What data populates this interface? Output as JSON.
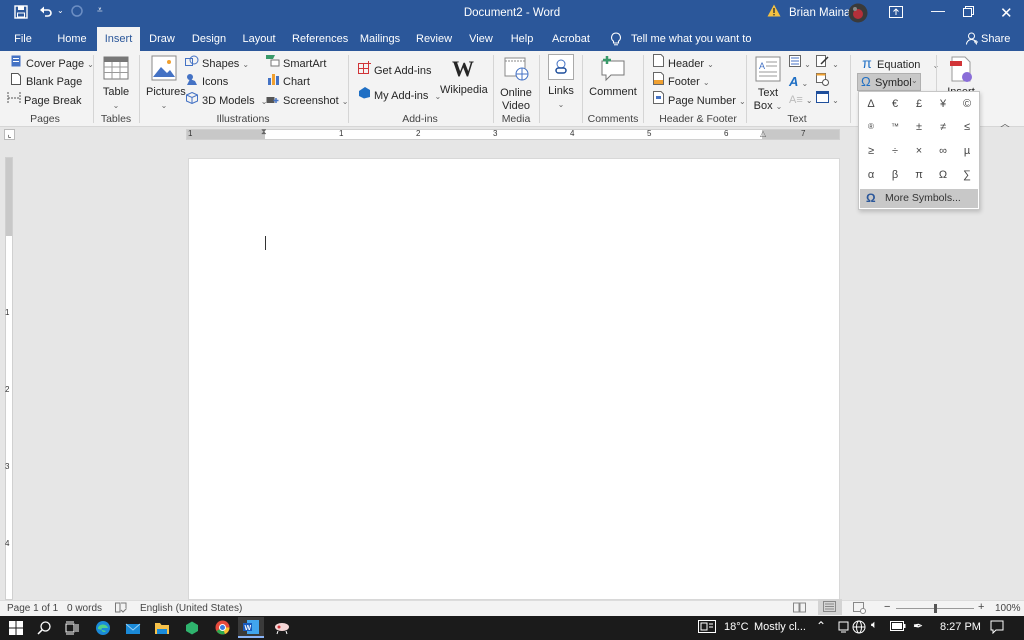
{
  "window": {
    "title": "Document2  -  Word",
    "user_name": "Brian Maina",
    "warning_icon": "warning-icon",
    "controls": {
      "ribbon_display": "ribbon-display-icon",
      "minimize": "minimize-icon",
      "restore": "restore-icon",
      "close": "close-icon"
    }
  },
  "quick_access": {
    "save": "save-icon",
    "undo": "undo-icon",
    "redo": "redo-icon",
    "customize": "customize-icon"
  },
  "tabs": [
    {
      "label": "File"
    },
    {
      "label": "Home"
    },
    {
      "label": "Insert",
      "active": true
    },
    {
      "label": "Draw"
    },
    {
      "label": "Design"
    },
    {
      "label": "Layout"
    },
    {
      "label": "References"
    },
    {
      "label": "Mailings"
    },
    {
      "label": "Review"
    },
    {
      "label": "View"
    },
    {
      "label": "Help"
    },
    {
      "label": "Acrobat"
    }
  ],
  "tell_me": "Tell me what you want to do",
  "share_label": "Share",
  "ribbon": {
    "pages": {
      "label": "Pages",
      "cover_page": "Cover Page",
      "blank_page": "Blank Page",
      "page_break": "Page Break"
    },
    "tables": {
      "label": "Tables",
      "table": "Table"
    },
    "illustrations": {
      "label": "Illustrations",
      "pictures": "Pictures",
      "shapes": "Shapes",
      "icons": "Icons",
      "models": "3D Models",
      "smartart": "SmartArt",
      "chart": "Chart",
      "screenshot": "Screenshot"
    },
    "addins": {
      "label": "Add-ins",
      "get": "Get Add-ins",
      "my": "My Add-ins",
      "wikipedia": "Wikipedia"
    },
    "media": {
      "label": "Media",
      "online_video_1": "Online",
      "online_video_2": "Video"
    },
    "links": {
      "label": "Links"
    },
    "comments": {
      "label": "Comments",
      "comment": "Comment"
    },
    "header_footer": {
      "label": "Header & Footer",
      "header": "Header",
      "footer": "Footer",
      "page_number": "Page Number"
    },
    "text": {
      "label": "Text",
      "text_box_1": "Text",
      "text_box_2": "Box"
    },
    "symbols": {
      "equation": "Equation",
      "symbol": "Symbol"
    },
    "insert_partial": "Insert"
  },
  "symbol_dropdown": {
    "symbols": [
      "Δ",
      "€",
      "£",
      "¥",
      "©",
      "®",
      "™",
      "±",
      "≠",
      "≤",
      "≥",
      "÷",
      "×",
      "∞",
      "µ",
      "α",
      "β",
      "π",
      "Ω",
      "∑"
    ],
    "more_symbols": "More Symbols..."
  },
  "ruler": {
    "h_numbers": [
      "1",
      "1",
      "2",
      "3",
      "4",
      "5",
      "6",
      "7"
    ],
    "v_numbers": [
      "1",
      "2",
      "3",
      "4"
    ]
  },
  "status": {
    "page": "Page 1 of 1",
    "words": "0 words",
    "language": "English (United States)",
    "zoom": "100%",
    "zoom_fraction": 0.5
  },
  "taskbar": {
    "weather_temp": "18°C",
    "weather_text": "Mostly cl...",
    "time": "8:27 PM"
  }
}
